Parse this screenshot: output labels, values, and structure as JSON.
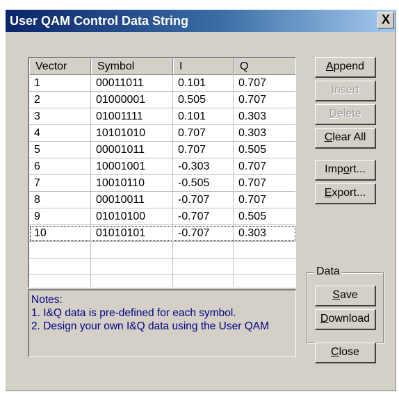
{
  "window": {
    "title": "User QAM  Control Data String",
    "close_glyph": "X"
  },
  "table": {
    "headers": [
      "Vector",
      "Symbol",
      "I",
      "Q"
    ],
    "rows": [
      [
        "1",
        "00011011",
        "0.101",
        "0.707"
      ],
      [
        "2",
        "01000001",
        "0.505",
        "0.707"
      ],
      [
        "3",
        "01001111",
        "0.101",
        "0.303"
      ],
      [
        "4",
        "10101010",
        "0.707",
        "0.303"
      ],
      [
        "5",
        "00001011",
        "0.707",
        "0.505"
      ],
      [
        "6",
        "10001001",
        "-0.303",
        "0.707"
      ],
      [
        "7",
        "10010110",
        "-0.505",
        "0.707"
      ],
      [
        "8",
        "00010011",
        "-0.707",
        "0.707"
      ],
      [
        "9",
        "01010100",
        "-0.707",
        "0.505"
      ],
      [
        "10",
        "01010101",
        "-0.707",
        "0.303"
      ]
    ],
    "empty_rows": 3
  },
  "notes": {
    "title": "Notes:",
    "line1": "1. I&Q data is pre-defined for each symbol.",
    "line2": "2. Design your own I&Q data using the User QAM"
  },
  "buttons": {
    "append": {
      "label": "Append",
      "accel": "A",
      "rest": "ppend",
      "enabled": true
    },
    "insert": {
      "label": "Insert",
      "accel": "I",
      "rest": "nsert",
      "enabled": false
    },
    "delete": {
      "label": "Delete",
      "accel": "D",
      "rest": "elete",
      "enabled": false
    },
    "clear_all": {
      "label": "Clear All",
      "accel": "C",
      "rest": "lear All",
      "enabled": true
    },
    "import": {
      "label": "Import...",
      "pre": "Imp",
      "accel": "o",
      "rest": "rt...",
      "enabled": true
    },
    "export": {
      "label": "Export...",
      "accel": "E",
      "rest": "xport...",
      "enabled": true
    },
    "save": {
      "label": "Save",
      "accel": "S",
      "rest": "ave",
      "enabled": true
    },
    "download": {
      "label": "Download",
      "accel": "D",
      "rest": "ownload",
      "enabled": true
    },
    "close": {
      "label": "Close",
      "accel": "C",
      "rest": "lose",
      "enabled": true
    }
  },
  "data_group": {
    "label": "Data"
  },
  "focused_row": 10
}
